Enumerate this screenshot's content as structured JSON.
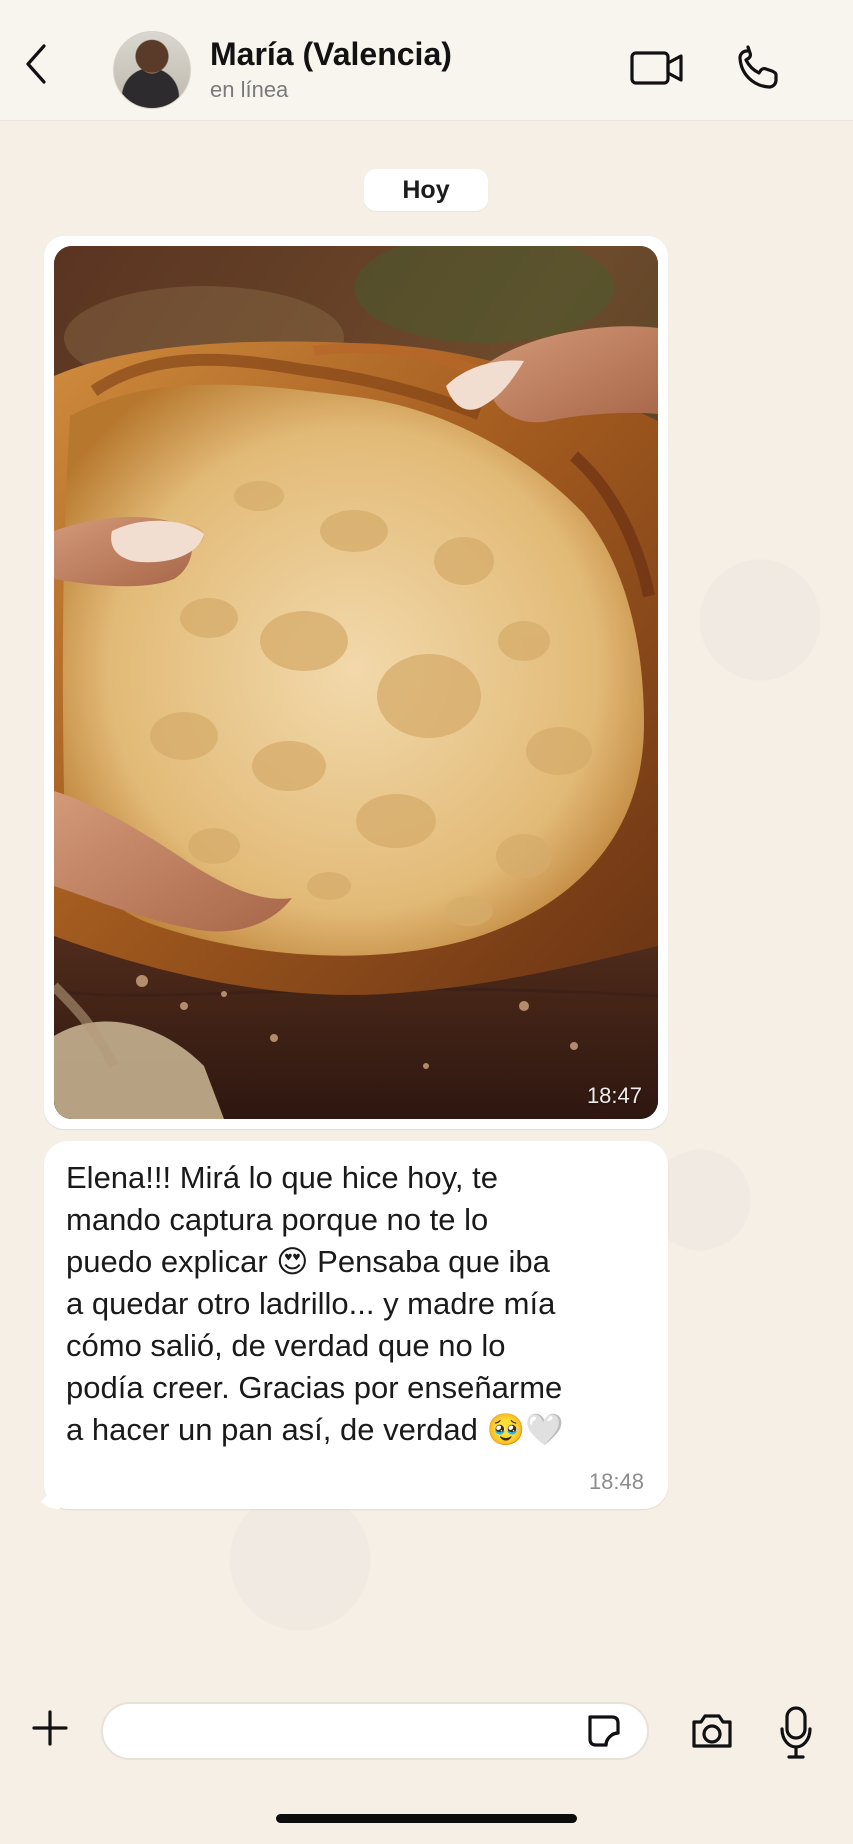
{
  "header": {
    "contact_name": "María (Valencia)",
    "status": "en línea",
    "icons": {
      "back": "chevron-left-icon",
      "video": "video-camera-icon",
      "call": "phone-icon"
    }
  },
  "chat": {
    "date_chip": "Hoy",
    "image_message": {
      "time": "18:47"
    },
    "text_message": {
      "text": "Elena!!! Mirá lo que hice hoy, te\nmando captura porque no te lo\npuedo explicar 😍 Pensaba que iba\na quedar otro ladrillo... y madre mía\ncómo salió, de verdad que no lo\npodía creer. Gracias por enseñarme\na hacer un pan así, de verdad 🥹🤍",
      "time": "18:48"
    }
  },
  "composer": {
    "placeholder": "",
    "icons": {
      "plus": "plus-icon",
      "sticker": "sticker-icon",
      "camera": "camera-icon",
      "mic": "microphone-icon"
    }
  },
  "colors": {
    "chat_background": "#f5efe6",
    "header_background": "#f8f4ee",
    "bubble_background": "#ffffff",
    "text_primary": "#1a1a1a",
    "text_secondary": "#8d8d8d"
  }
}
